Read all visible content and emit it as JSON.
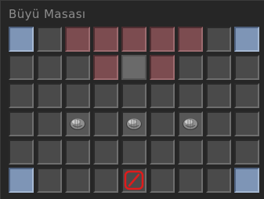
{
  "window": {
    "title": "Büyü Masası"
  },
  "slots": [
    [
      "blue",
      "normal",
      "red",
      "red",
      "red",
      "red",
      "red",
      "normal",
      "blue"
    ],
    [
      "normal",
      "normal",
      "normal",
      "red",
      "center",
      "red",
      "normal",
      "normal",
      "normal"
    ],
    [
      "normal",
      "normal",
      "normal",
      "normal",
      "normal",
      "normal",
      "normal",
      "normal",
      "normal"
    ],
    [
      "normal",
      "normal",
      "item",
      "normal",
      "item",
      "normal",
      "item",
      "normal",
      "normal"
    ],
    [
      "normal",
      "normal",
      "normal",
      "normal",
      "normal",
      "normal",
      "normal",
      "normal",
      "normal"
    ],
    [
      "blue",
      "normal",
      "normal",
      "normal",
      "blocked",
      "normal",
      "normal",
      "normal",
      "blue"
    ]
  ],
  "icons": {
    "item": "stone-orb-icon",
    "blocked": "no-entry-icon"
  },
  "colors": {
    "blue_slot": "#7e95b6",
    "red_slot": "#7c4c50",
    "blocked": "#e01b1b"
  }
}
